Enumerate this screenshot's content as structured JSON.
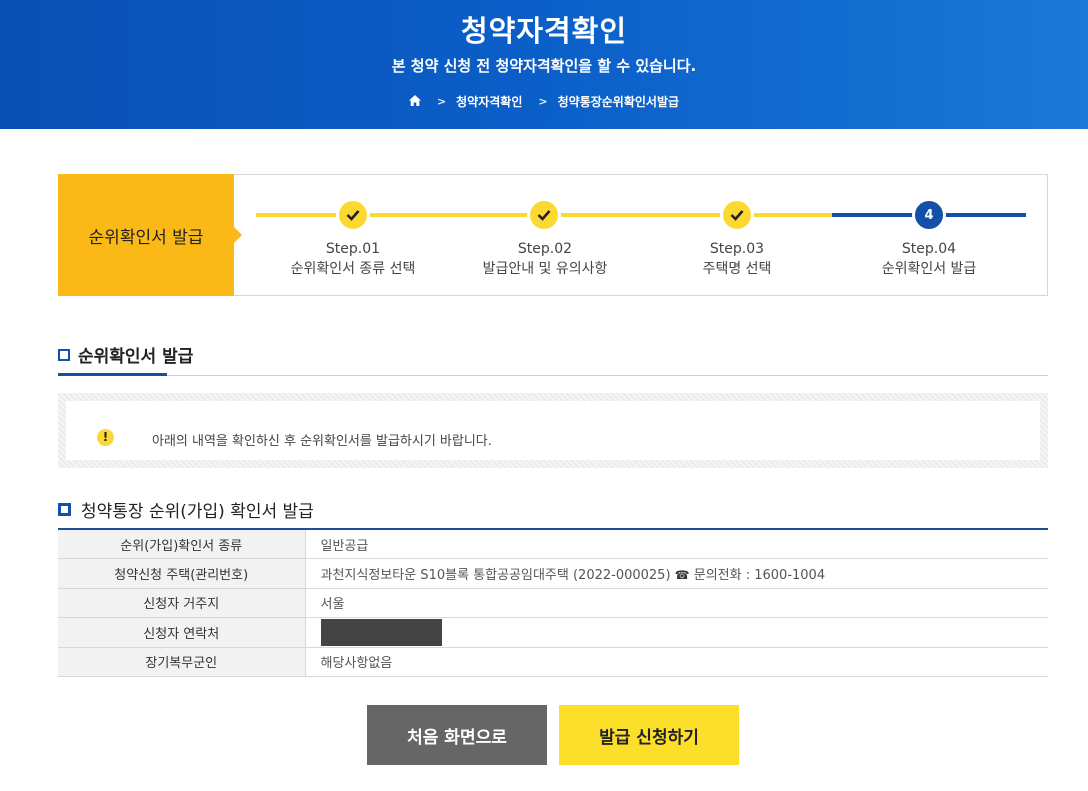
{
  "header": {
    "title": "청약자격확인",
    "subtitle": "본 청약 신청 전 청약자격확인을 할 수 있습니다.",
    "breadcrumb": [
      "청약자격확인",
      "청약통장순위확인서발급"
    ]
  },
  "stepper": {
    "current_label": "순위확인서 발급",
    "steps": [
      {
        "step": "Step.01",
        "label": "순위확인서 종류 선택",
        "status": "done"
      },
      {
        "step": "Step.02",
        "label": "발급안내 및 유의사항",
        "status": "done"
      },
      {
        "step": "Step.03",
        "label": "주택명 선택",
        "status": "done"
      },
      {
        "step": "Step.04",
        "label": "순위확인서 발급",
        "status": "active",
        "number": "4"
      }
    ]
  },
  "section_title": "순위확인서 발급",
  "notice": {
    "icon_glyph": "!",
    "text": "아래의 내역을 확인하신 후 순위확인서를 발급하시기 바랍니다."
  },
  "table_title": "청약통장 순위(가입) 확인서 발급",
  "table": {
    "rows": [
      {
        "label": "순위(가입)확인서 종류",
        "value": "일반공급"
      },
      {
        "label": "청약신청 주택(관리번호)",
        "value": "과천지식정보타운 S10블록 통합공공임대주택 (2022-000025)",
        "phone_glyph": "☎",
        "phone": "문의전화 : 1600-1004"
      },
      {
        "label": "신청자 거주지",
        "value": "서울"
      },
      {
        "label": "신청자 연락처",
        "value": ""
      },
      {
        "label": "장기복무군인",
        "value": "해당사항없음"
      }
    ]
  },
  "buttons": {
    "home": "처음 화면으로",
    "apply": "발급 신청하기"
  },
  "colors": {
    "primary_blue": "#1550a8",
    "accent_yellow": "#fbd932",
    "current_step_bg": "#fbb917"
  }
}
